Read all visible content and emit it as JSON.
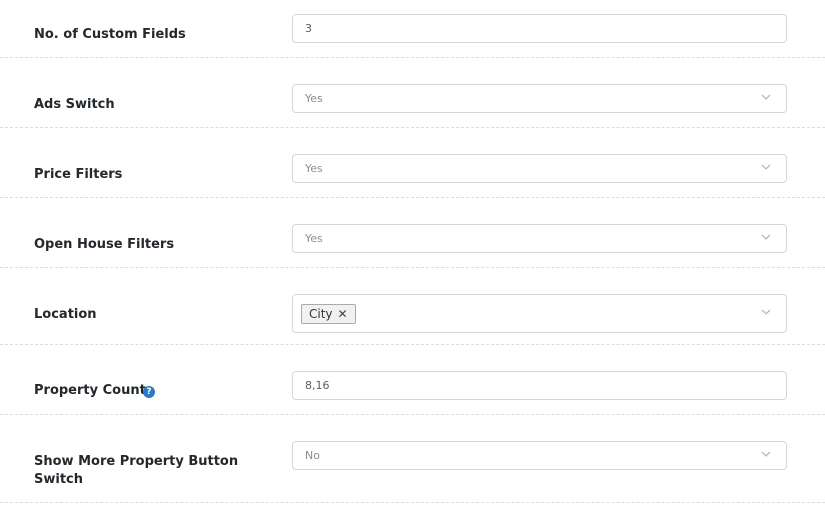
{
  "settings": {
    "custom_fields": {
      "label": "No. of Custom Fields",
      "value": "3"
    },
    "ads_switch": {
      "label": "Ads Switch",
      "value": "Yes"
    },
    "price_filters": {
      "label": "Price Filters",
      "value": "Yes"
    },
    "open_house_filters": {
      "label": "Open House Filters",
      "value": "Yes"
    },
    "location": {
      "label": "Location",
      "tags": [
        "City"
      ],
      "remove_glyph": "✕"
    },
    "property_count": {
      "label": "Property Count",
      "value": "8,16",
      "help_glyph": "?"
    },
    "show_more": {
      "label": "Show More Property Button Switch",
      "value": "No"
    }
  },
  "icons": {
    "chevron": "chevron-down-icon",
    "help": "help-icon",
    "remove": "close-icon"
  },
  "colors": {
    "help_icon": "#2b79c4",
    "border": "#d6d6d6",
    "separator": "#dcdcdc"
  }
}
